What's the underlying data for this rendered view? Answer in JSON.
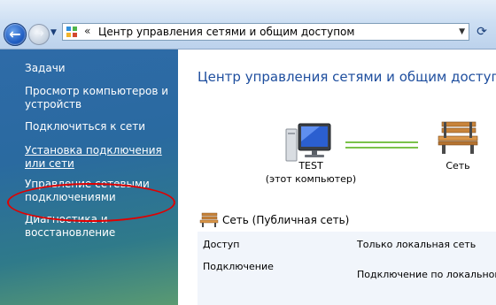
{
  "navigation": {
    "address_sep": "«",
    "address_text": "Центр управления сетями и общим доступом",
    "back_glyph": "←",
    "forward_glyph": "→",
    "refresh_glyph": "⟳",
    "dropdown_glyph": "▼"
  },
  "sidebar": {
    "title": "Задачи",
    "items": [
      {
        "label": "Просмотр компьютеров и устройств"
      },
      {
        "label": "Подключиться к сети"
      },
      {
        "label": "Установка подключения или сети"
      },
      {
        "label": "Управление сетевыми подключениями"
      },
      {
        "label": "Диагностика и восстановление"
      }
    ]
  },
  "main": {
    "title": "Центр управления сетями и общим доступом",
    "computer_name": "TEST",
    "computer_sub": "(этот компьютер)",
    "network_label": "Сеть",
    "network_header": "Сеть (Публичная сеть)",
    "details": [
      {
        "label": "Доступ",
        "value": "Только локальная сеть"
      },
      {
        "label": "Подключение",
        "value": "Подключение по локальной"
      }
    ]
  },
  "colors": {
    "title_blue": "#1e4e9e",
    "link_green": "#7bc24a",
    "highlight_red": "#e00000"
  }
}
